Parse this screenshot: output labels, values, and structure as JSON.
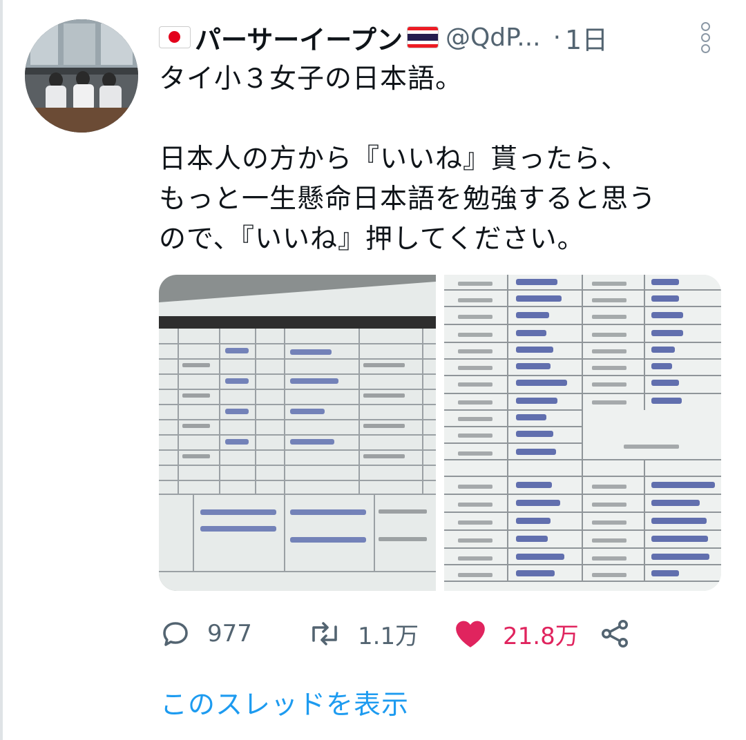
{
  "tweet": {
    "author": {
      "display_name": "パーサーイープン",
      "handle": "@QdP...",
      "flags": [
        "japan-flag",
        "thailand-flag"
      ]
    },
    "timestamp": "1日",
    "text_lines": [
      "タイ小３女子の日本語。",
      "",
      "日本人の方から『いいね』貰ったら、",
      "もっと一生懸命日本語を勉強すると思う",
      "ので、『いいね』押してください。"
    ],
    "media": {
      "count": 2
    },
    "actions": {
      "replies": "977",
      "retweets": "1.1万",
      "likes": "21.8万"
    },
    "show_thread": "このスレッドを表示"
  },
  "colors": {
    "like": "#e0245e",
    "link": "#1d9bf0",
    "secondary_text": "#536471"
  }
}
